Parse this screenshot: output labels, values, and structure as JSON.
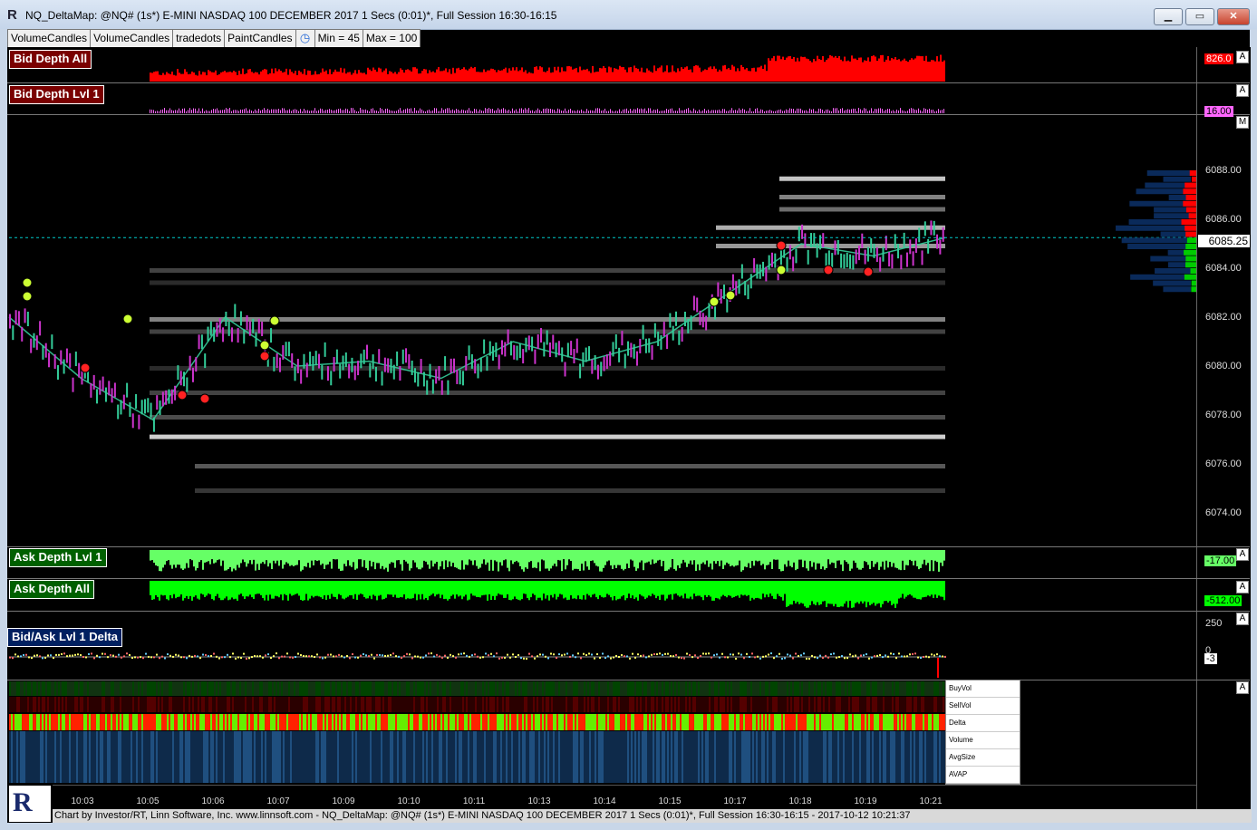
{
  "window": {
    "app_icon": "R",
    "title": "NQ_DeltaMap: @NQ# (1s*) E-MINI NASDAQ 100 DECEMBER 2017 1 Secs (0:01)*, Full Session 16:30-16:15",
    "min_glyph": "▁",
    "max_glyph": "▭",
    "close_glyph": "✕"
  },
  "toolbar": {
    "items": [
      "VolumeCandles",
      "VolumeCandles",
      "tradedots",
      "PaintCandles"
    ],
    "clock_icon": "clock-icon",
    "min_label": "Min = 45",
    "max_label": "Max = 100"
  },
  "panes": {
    "bid_depth_all": {
      "label": "Bid Depth All",
      "value": "826.0"
    },
    "bid_depth_lvl1": {
      "label": "Bid Depth Lvl 1",
      "value": "16.00"
    },
    "ask_depth_lvl1": {
      "label": "Ask Depth Lvl 1",
      "value": "-17.00"
    },
    "ask_depth_all": {
      "label": "Ask Depth All",
      "value": "-512.00"
    },
    "delta": {
      "label": "Bid/Ask Lvl 1 Delta",
      "value": "-3",
      "top_tick": "250",
      "mid_tick": "0"
    }
  },
  "scale_buttons": {
    "a": "A",
    "m": "M"
  },
  "price_axis": {
    "ticks": [
      "6088.00",
      "6086.00",
      "6084.00",
      "6082.00",
      "6080.00",
      "6078.00",
      "6076.00",
      "6074.00"
    ],
    "last_price": "6085.25"
  },
  "legend": [
    "BuyVol",
    "SellVol",
    "Delta",
    "Volume",
    "AvgSize",
    "AVAP"
  ],
  "time_axis": [
    "10:03",
    "10:05",
    "10:06",
    "10:07",
    "10:09",
    "10:10",
    "10:11",
    "10:13",
    "10:14",
    "10:15",
    "10:17",
    "10:18",
    "10:19",
    "10:21"
  ],
  "footer": "Chart by Investor/RT, Linn Software, Inc. www.linnsoft.com - NQ_DeltaMap: @NQ# (1s*) E-MINI NASDAQ 100 DECEMBER 2017 1 Secs (0:01)*, Full Session 16:30-16:15 - 2017-10-12 10:21:37",
  "colors": {
    "bid": "#ff0000",
    "bid_lvl1": "#ff66ff",
    "ask_lvl1": "#66ff66",
    "ask_all": "#00ff00",
    "up_candle": "#33cc99",
    "down_candle": "#cc33cc",
    "last_line": "#00cccc"
  },
  "chart_data": {
    "type": "line",
    "title": "",
    "xlabel": "",
    "ylabel": "",
    "ylim": [
      6073,
      6089
    ],
    "x": [
      "10:03",
      "10:05",
      "10:06",
      "10:07",
      "10:09",
      "10:10",
      "10:11",
      "10:13",
      "10:14",
      "10:15",
      "10:17",
      "10:18",
      "10:19",
      "10:21"
    ],
    "series": [
      {
        "values": [
          6082.0,
          6079.5,
          6077.8,
          6082.0,
          6080.0,
          6080.2,
          6079.5,
          6081.0,
          6080.2,
          6081.0,
          6083.0,
          6085.0,
          6084.5,
          6085.25
        ]
      }
    ],
    "heatmap_levels": [
      {
        "price": 6087.75,
        "intensity": 0.9
      },
      {
        "price": 6087.0,
        "intensity": 0.6
      },
      {
        "price": 6086.5,
        "intensity": 0.5
      },
      {
        "price": 6085.75,
        "intensity": 0.8
      },
      {
        "price": 6085.0,
        "intensity": 0.7
      },
      {
        "price": 6084.0,
        "intensity": 0.3
      },
      {
        "price": 6083.5,
        "intensity": 0.2
      },
      {
        "price": 6082.0,
        "intensity": 0.6
      },
      {
        "price": 6081.5,
        "intensity": 0.3
      },
      {
        "price": 6080.0,
        "intensity": 0.2
      },
      {
        "price": 6079.0,
        "intensity": 0.3
      },
      {
        "price": 6078.0,
        "intensity": 0.35
      },
      {
        "price": 6077.2,
        "intensity": 0.95
      },
      {
        "price": 6076.0,
        "intensity": 0.4
      },
      {
        "price": 6075.0,
        "intensity": 0.25
      }
    ]
  }
}
